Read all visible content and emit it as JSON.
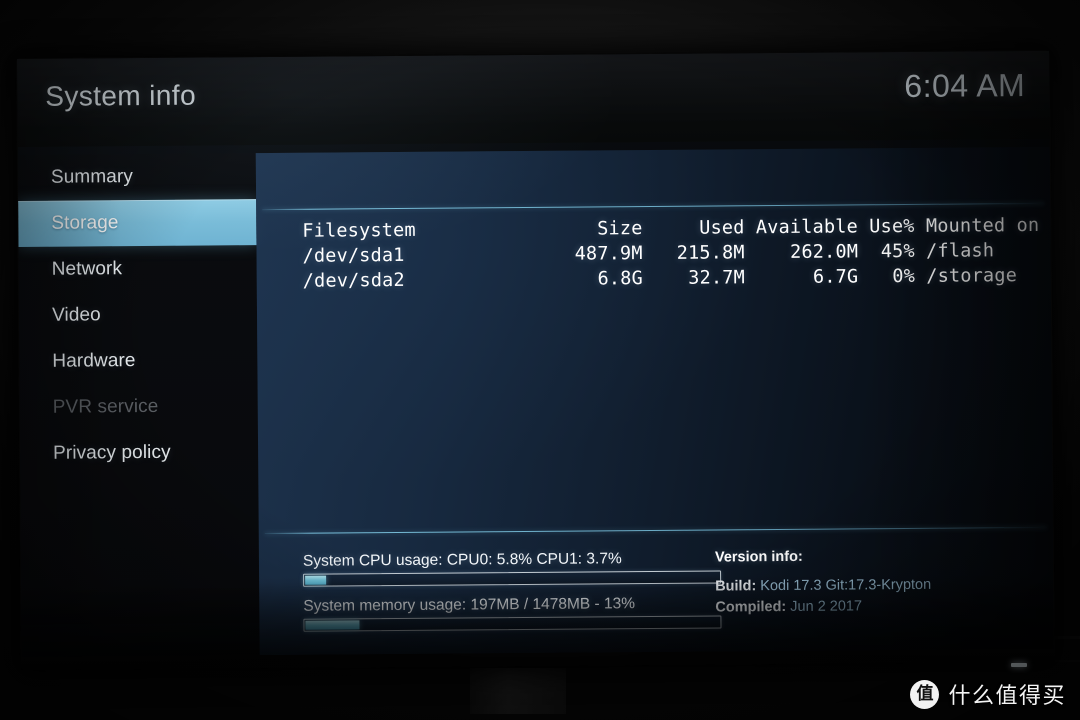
{
  "header": {
    "title": "System info",
    "clock": "6:04 AM"
  },
  "sidebar": {
    "items": [
      {
        "label": "Summary",
        "state": "normal"
      },
      {
        "label": "Storage",
        "state": "selected"
      },
      {
        "label": "Network",
        "state": "normal"
      },
      {
        "label": "Video",
        "state": "normal"
      },
      {
        "label": "Hardware",
        "state": "normal"
      },
      {
        "label": "PVR service",
        "state": "disabled"
      },
      {
        "label": "Privacy policy",
        "state": "normal"
      }
    ]
  },
  "storage": {
    "columns": [
      "Filesystem",
      "Size",
      "Used",
      "Available",
      "Use%",
      "Mounted on"
    ],
    "rows": [
      {
        "filesystem": "/dev/sda1",
        "size": "487.9M",
        "used": "215.8M",
        "available": "262.0M",
        "use_pct": "45%",
        "mounted_on": "/flash"
      },
      {
        "filesystem": "/dev/sda2",
        "size": "6.8G",
        "used": "32.7M",
        "available": "6.7G",
        "use_pct": "0%",
        "mounted_on": "/storage"
      }
    ],
    "table_text": "Filesystem                Size     Used Available Use% Mounted on\n/dev/sda1               487.9M   215.8M    262.0M  45% /flash\n/dev/sda2                 6.8G    32.7M      6.7G   0% /storage"
  },
  "stats": {
    "cpu": {
      "label": "System CPU usage: CPU0: 5.8% CPU1: 3.7%",
      "cpu0_pct": 5.8,
      "cpu1_pct": 3.7,
      "bar_fill_pct": "5%"
    },
    "memory": {
      "label": "System memory usage: 197MB / 1478MB - 13%",
      "used_mb": 197,
      "total_mb": 1478,
      "percent": 13,
      "bar_fill_pct": "13%"
    }
  },
  "version": {
    "title": "Version info:",
    "build_key": "Build:",
    "build_value": "Kodi 17.3 Git:17.3-Krypton",
    "compiled_key": "Compiled:",
    "compiled_value": "Jun  2 2017"
  },
  "watermark": {
    "logo_char": "值",
    "text": "什么值得买"
  },
  "colors": {
    "accent_cyan": "#79bcd8",
    "panel_blue": "#1f3652",
    "text_primary": "#eef3f6",
    "text_disabled": "#5d6166",
    "rule_cyan": "#7cc5e0"
  }
}
